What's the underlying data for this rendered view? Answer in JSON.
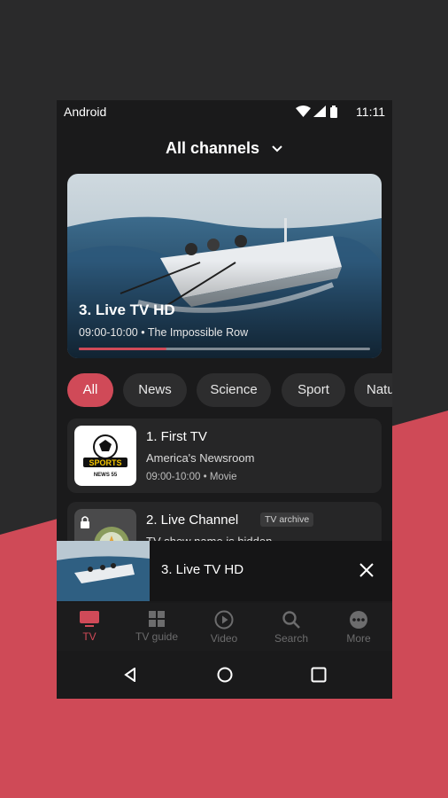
{
  "status_bar": {
    "os_label": "Android",
    "time": "11:11"
  },
  "header": {
    "title": "All channels"
  },
  "hero": {
    "title": "3. Live TV HD",
    "time": "09:00-10:00",
    "separator": "•",
    "program": "The Impossible Row",
    "progress": 0.3
  },
  "filters": [
    "All",
    "News",
    "Science",
    "Sport",
    "Natu"
  ],
  "channels": [
    {
      "title": "1. First TV",
      "subtitle": "America's Newsroom",
      "time": "09:00-10:00",
      "separator": "•",
      "genre": "Movie",
      "logo_text": "SPORTS",
      "logo_sub": "NEWS 55"
    },
    {
      "title": "2. Live Channel",
      "badge": "TV archive",
      "subtitle": "TV show name is hidden"
    }
  ],
  "mini_player": {
    "title": "3. Live TV HD"
  },
  "bottom_nav": [
    {
      "label": "TV",
      "icon": "tv-icon",
      "active": true
    },
    {
      "label": "TV guide",
      "icon": "grid-icon",
      "active": false
    },
    {
      "label": "Video",
      "icon": "play-icon",
      "active": false
    },
    {
      "label": "Search",
      "icon": "search-icon",
      "active": false
    },
    {
      "label": "More",
      "icon": "more-icon",
      "active": false
    }
  ],
  "colors": {
    "accent": "#d04a58",
    "background": "#1a1a1b",
    "card": "#262627"
  }
}
